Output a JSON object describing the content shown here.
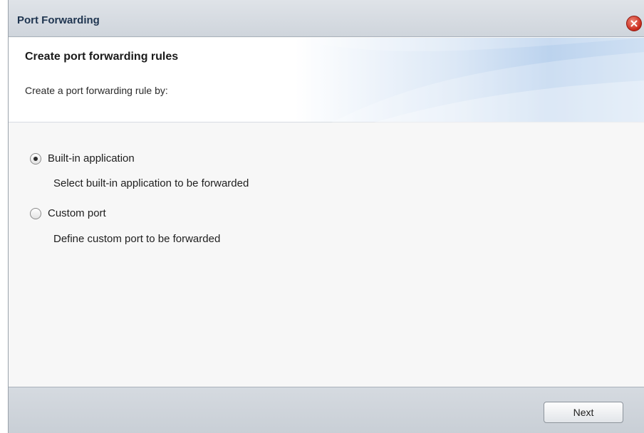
{
  "window": {
    "title": "Port Forwarding"
  },
  "header": {
    "step_title": "Create port forwarding rules",
    "step_description": "Create a port forwarding rule by:"
  },
  "options": [
    {
      "label": "Built-in application",
      "description": "Select built-in application to be forwarded",
      "selected": true
    },
    {
      "label": "Custom port",
      "description": "Define custom port to be forwarded",
      "selected": false
    }
  ],
  "footer": {
    "next_label": "Next"
  },
  "colors": {
    "titlebar": "#cfd5dc",
    "close_button": "#c8281a",
    "header_accent": "#bcd3ee",
    "footer": "#c9cfd6"
  },
  "icons": {
    "close": "close-icon"
  }
}
